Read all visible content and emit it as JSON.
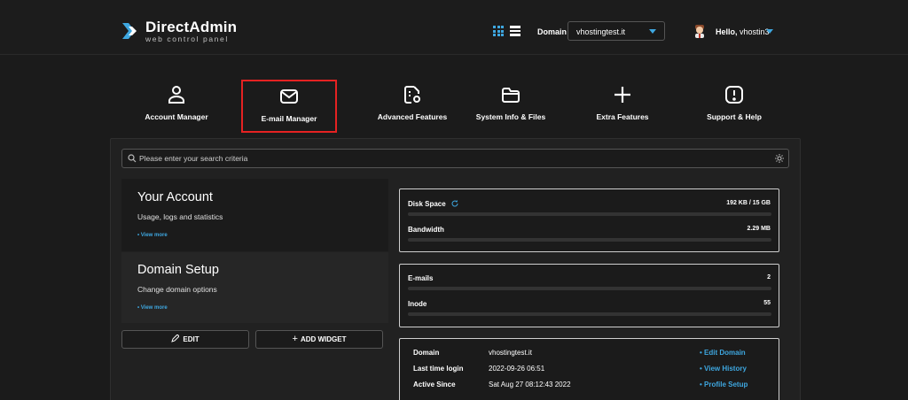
{
  "brand": {
    "title": "DirectAdmin",
    "subtitle": "web control panel"
  },
  "header": {
    "domain_label": "Domain",
    "domain_value": "vhostingtest.it",
    "greeting": "Hello,",
    "username": "vhostin3"
  },
  "nav": [
    {
      "label": "Account Manager",
      "icon": "user-icon"
    },
    {
      "label": "E-mail Manager",
      "icon": "envelope-icon"
    },
    {
      "label": "Advanced Features",
      "icon": "file-gear-icon"
    },
    {
      "label": "System Info & Files",
      "icon": "folder-icon"
    },
    {
      "label": "Extra Features",
      "icon": "plus-icon"
    },
    {
      "label": "Support & Help",
      "icon": "alert-icon"
    }
  ],
  "search": {
    "placeholder": "Please enter your search criteria"
  },
  "cards": [
    {
      "title": "Your Account",
      "subtitle": "Usage, logs and statistics",
      "more": "• View more"
    },
    {
      "title": "Domain Setup",
      "subtitle": "Change domain options",
      "more": "• View more"
    }
  ],
  "buttons": {
    "edit": "EDIT",
    "add_widget": "ADD WIDGET"
  },
  "usage": {
    "disk_label": "Disk Space",
    "disk_value": "192 KB / 15 GB",
    "bandwidth_label": "Bandwidth",
    "bandwidth_value": "2.29 MB",
    "emails_label": "E-mails",
    "emails_value": "2",
    "inode_label": "Inode",
    "inode_value": "55"
  },
  "info": {
    "domain_label": "Domain",
    "domain_value": "vhostingtest.it",
    "domain_link": "• Edit Domain",
    "login_label": "Last time login",
    "login_value": "2022-09-26 06:51",
    "login_link": "• View History",
    "since_label": "Active Since",
    "since_value": "Sat Aug 27 08:12:43 2022",
    "since_link": "• Profile Setup"
  },
  "colors": {
    "accent": "#3ea7e0",
    "highlight": "#e52222",
    "background": "#1b1b1b"
  }
}
